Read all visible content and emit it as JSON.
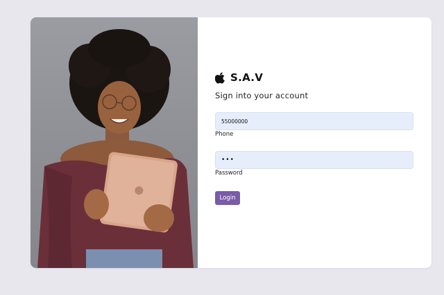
{
  "brand": {
    "name": "S.A.V",
    "logo_icon": "apple-logo-icon"
  },
  "form": {
    "subtitle": "Sign into your account",
    "phone": {
      "value": "55000000",
      "label": "Phone"
    },
    "password": {
      "value": "•••",
      "label": "Password"
    },
    "login_label": "Login"
  },
  "colors": {
    "page_background": "#e8e7ee",
    "card_background": "#ffffff",
    "input_background": "#e7eefb",
    "button_background": "#7a5ba8",
    "button_text": "#ffffff"
  }
}
